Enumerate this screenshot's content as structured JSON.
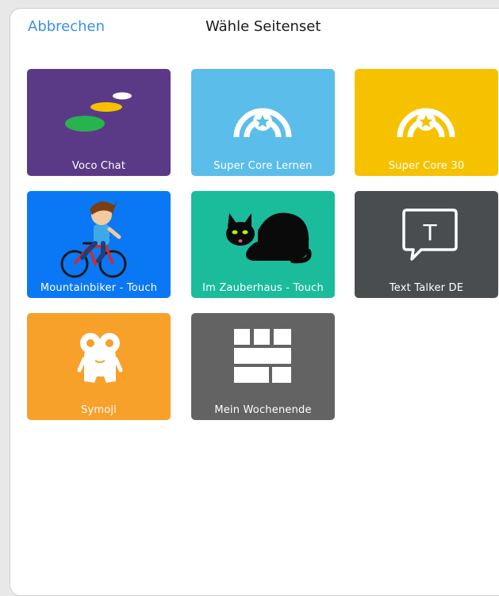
{
  "header": {
    "cancel_label": "Abbrechen",
    "title": "Wähle Seitenset"
  },
  "tiles": [
    {
      "label": "Voco Chat",
      "color": "#5a3a86",
      "icon": "voco-chat-icon"
    },
    {
      "label": "Super Core Lernen",
      "color": "#5bbde9",
      "icon": "star-rainbow-icon"
    },
    {
      "label": "Super Core 30",
      "color": "#f6c200",
      "icon": "star-rainbow-icon"
    },
    {
      "label": "Mountainbiker - Touch",
      "color": "#0a78f5",
      "icon": "cyclist-icon"
    },
    {
      "label": "Im Zauberhaus - Touch",
      "color": "#1abc9c",
      "icon": "black-cat-icon"
    },
    {
      "label": "Text Talker DE",
      "color": "#4a4d50",
      "icon": "speech-bubble-t-icon"
    },
    {
      "label": "Symoji",
      "color": "#f7a12a",
      "icon": "symoji-character-icon"
    },
    {
      "label": "Mein Wochenende",
      "color": "#636363",
      "icon": "brick-wall-icon"
    }
  ]
}
